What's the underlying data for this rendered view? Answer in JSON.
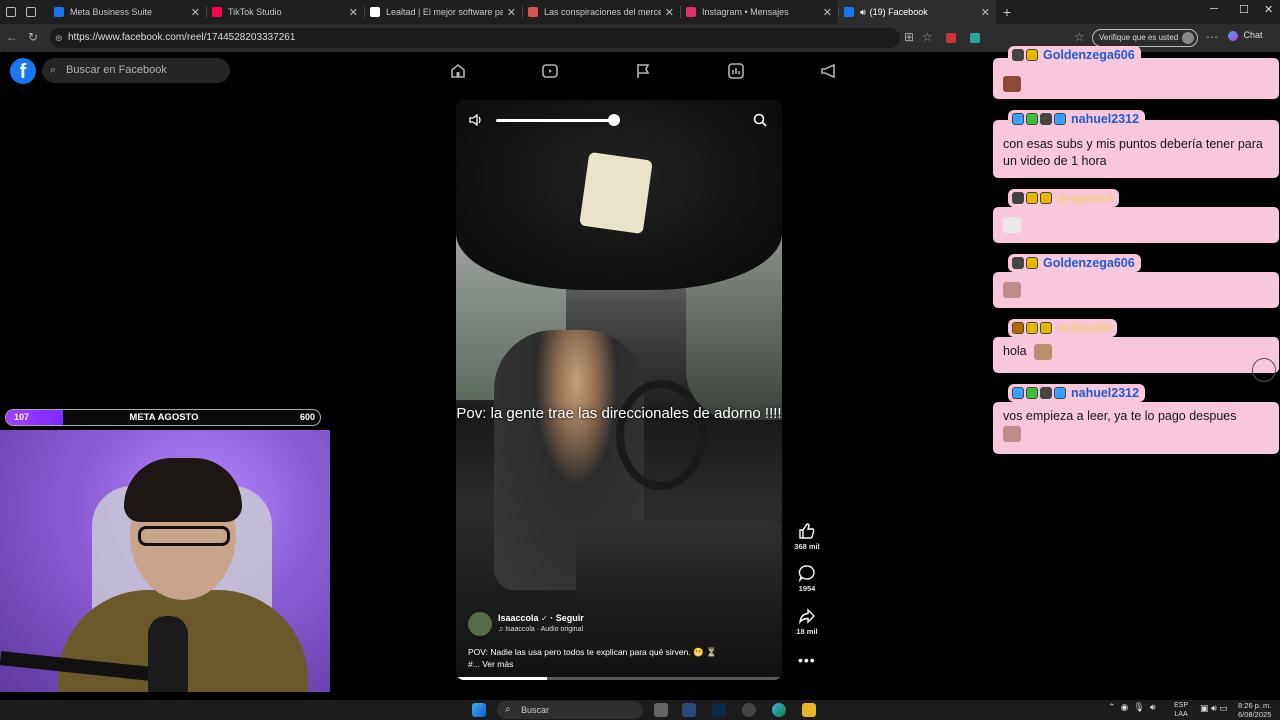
{
  "browser": {
    "tabs": [
      {
        "label": "Meta Business Suite",
        "active": false,
        "favicon_color": "#1877f2"
      },
      {
        "label": "TikTok Studio",
        "active": false,
        "favicon_color": "#ff0050"
      },
      {
        "label": "Lealtad | El mejor software para pu",
        "active": false,
        "favicon_color": "#ffffff"
      },
      {
        "label": "Las conspiraciones del mercenario",
        "active": false,
        "favicon_color": "#d9534f"
      },
      {
        "label": "Instagram • Mensajes",
        "active": false,
        "favicon_color": "#e1306c"
      },
      {
        "label": "(19) Facebook",
        "active": true,
        "favicon_color": "#1877f2"
      }
    ],
    "url": "https://www.facebook.com/reel/1744528203337261",
    "profile_button": "Verifique que es usted",
    "chat_button": "Chat"
  },
  "facebook": {
    "search_placeholder": "Buscar en Facebook",
    "nav_icons": [
      "home-icon",
      "reels-icon",
      "pages-flag-icon",
      "gaming-icon",
      "ads-megaphone-icon"
    ]
  },
  "reel": {
    "caption_overlay": "Pov: la gente trae las direccionales de adorno !!!!",
    "author": "Isaaccola",
    "follow_label": "· Seguir",
    "audio": "Isaaccola · Audio original",
    "description": "POV: Nadie las usa pero todos te explican para qué sirven.",
    "description_more": "Ver más",
    "volume_level": 0.95,
    "progress": 0.28,
    "likes": "368 mil",
    "comments": "1954",
    "shares": "18 mil"
  },
  "goal": {
    "start": "107",
    "title": "META AGOSTO",
    "end": "600",
    "fill_fraction": 0.18
  },
  "chat": {
    "messages": [
      {
        "user": "Goldenzega606",
        "user_color": "#1a5fd0",
        "text": "",
        "badges": [
          "#444",
          "#e6b800"
        ]
      },
      {
        "user": "nahuel2312",
        "user_color": "#1a5fd0",
        "text": "con esas subs y mis puntos debería tener para un video de 1 hora",
        "badges": [
          "#3aa0ff",
          "#3cbf3c",
          "#444",
          "#3aa0ff"
        ]
      },
      {
        "user": "dragoexd",
        "user_color": "#f0d080",
        "text": "",
        "badges": [
          "#444",
          "#e6b800",
          "#e6b800"
        ]
      },
      {
        "user": "Goldenzega606",
        "user_color": "#1a5fd0",
        "text": "",
        "badges": [
          "#444",
          "#e6b800"
        ]
      },
      {
        "user": "neilmo00",
        "user_color": "#f0d080",
        "text": "hola",
        "badges": [
          "#b06a00",
          "#e6b800",
          "#e6b800"
        ]
      },
      {
        "user": "nahuel2312",
        "user_color": "#1a5fd0",
        "text": "vos empieza a leer, ya te lo pago despues",
        "badges": [
          "#3aa0ff",
          "#3cbf3c",
          "#444",
          "#3aa0ff"
        ]
      }
    ]
  },
  "taskbar": {
    "search_placeholder": "Buscar",
    "lang_line1": "ESP",
    "lang_line2": "LAA",
    "time": "8:26 p. m.",
    "date": "6/08/2025"
  },
  "colors": {
    "facebook_blue": "#1877f2",
    "chat_bubble": "#f8c7db",
    "goal_fill": "#a23dff"
  }
}
